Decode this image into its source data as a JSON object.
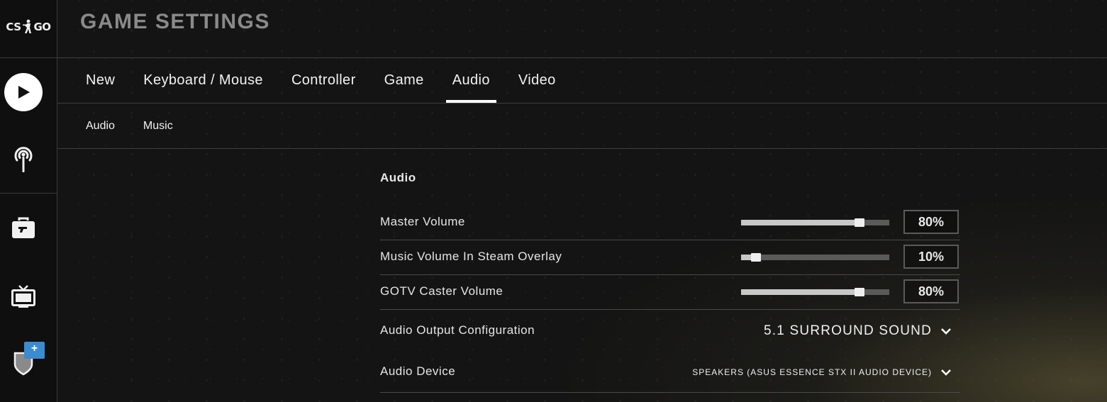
{
  "logo": {
    "left": "CS",
    "right": "GO"
  },
  "title": "GAME SETTINGS",
  "tabs": [
    {
      "label": "New"
    },
    {
      "label": "Keyboard / Mouse"
    },
    {
      "label": "Controller"
    },
    {
      "label": "Game"
    },
    {
      "label": "Audio",
      "active": true
    },
    {
      "label": "Video"
    }
  ],
  "subtabs": [
    {
      "label": "Audio"
    },
    {
      "label": "Music"
    }
  ],
  "section": {
    "title": "Audio"
  },
  "settings": {
    "master_volume": {
      "label": "Master Volume",
      "value": "80%",
      "level": 0.8
    },
    "music_volume_overlay": {
      "label": "Music Volume In Steam Overlay",
      "value": "10%",
      "level": 0.1
    },
    "gotv_caster_volume": {
      "label": "GOTV Caster Volume",
      "value": "80%",
      "level": 0.8
    },
    "audio_output_config": {
      "label": "Audio Output Configuration",
      "selected": "5.1 SURROUND SOUND"
    },
    "audio_device": {
      "label": "Audio Device",
      "selected": "SPEAKERS (ASUS ESSENCE STX II AUDIO DEVICE)"
    }
  },
  "rail_icons": [
    "play-icon",
    "broadcast-icon",
    "briefcase-icon",
    "tv-icon",
    "shield-icon"
  ],
  "badge": "+",
  "colors": {
    "slider_fill": "#c8c8c8",
    "slider_track": "#5a5a5a",
    "badge": "#3b8bd0",
    "title": "#8a8a8a"
  }
}
